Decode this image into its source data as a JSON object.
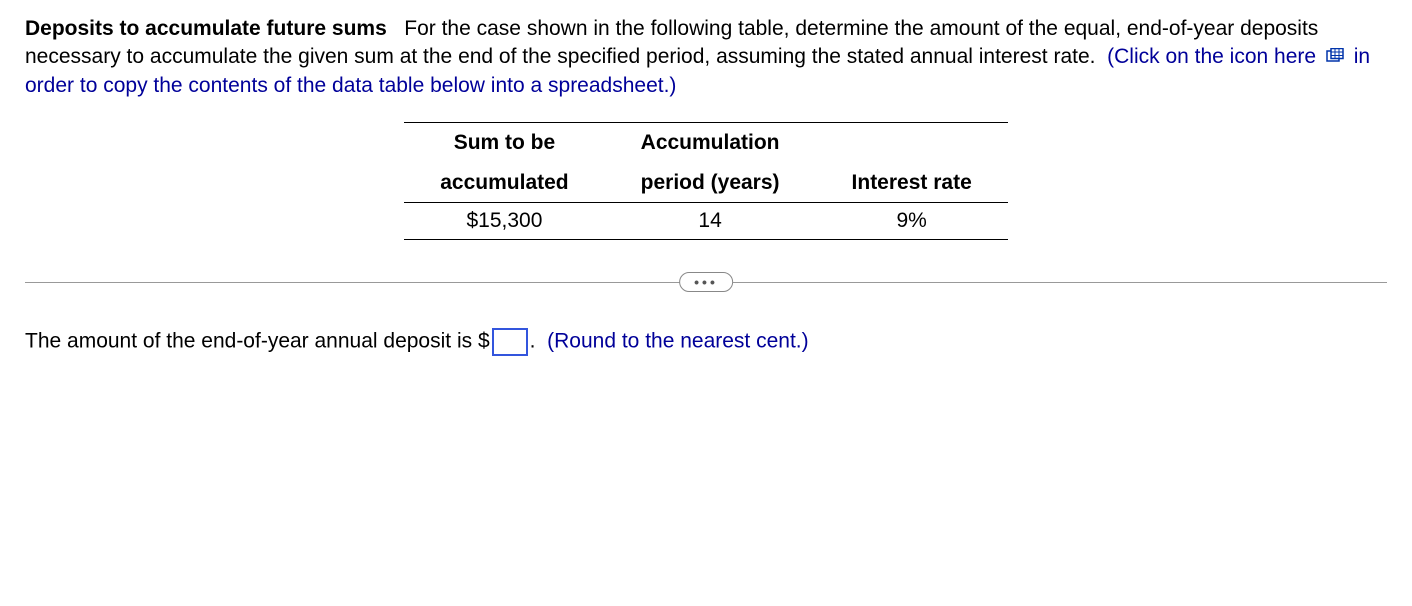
{
  "problem": {
    "title": "Deposits to accumulate future sums",
    "body1": "For the case shown in the following table, determine the amount of the equal, end-of-year deposits necessary to accumulate the given sum at the end of the specified period, assuming the stated annual interest rate.",
    "instruction_prefix": "(Click on the icon here",
    "instruction_suffix": "in order to copy the contents of the data table below into a spreadsheet.)"
  },
  "table": {
    "headers": {
      "col1_line1": "Sum to be",
      "col1_line2": "accumulated",
      "col2_line1": "Accumulation",
      "col2_line2": "period (years)",
      "col3_line1": "",
      "col3_line2": "Interest rate"
    },
    "row": {
      "sum": "$15,300",
      "period": "14",
      "rate": "9%"
    }
  },
  "ellipsis": "•••",
  "answer": {
    "prefix": "The amount of the end-of-year annual deposit is $",
    "value": "",
    "period": ".",
    "hint": "(Round to the nearest cent.)"
  }
}
